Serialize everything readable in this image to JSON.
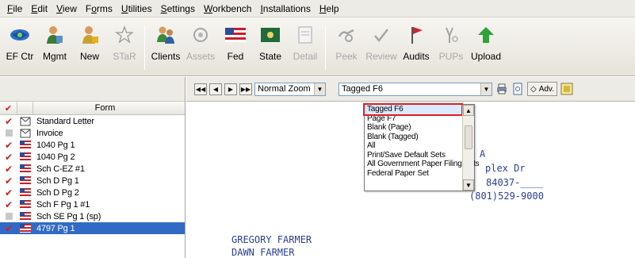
{
  "menu": [
    {
      "u": "F",
      "rest": "ile"
    },
    {
      "u": "E",
      "rest": "dit"
    },
    {
      "u": "V",
      "rest": "iew"
    },
    {
      "pre": "F",
      "u": "o",
      "rest": "rms"
    },
    {
      "u": "U",
      "rest": "tilities"
    },
    {
      "u": "S",
      "rest": "ettings"
    },
    {
      "u": "W",
      "rest": "orkbench"
    },
    {
      "u": "I",
      "rest": "nstallations"
    },
    {
      "u": "H",
      "rest": "elp"
    }
  ],
  "toolbar": {
    "ef_ctr": "EF Ctr",
    "mgmt": "Mgmt",
    "new": "New",
    "star": "STaR",
    "clients": "Clients",
    "assets": "Assets",
    "fed": "Fed",
    "state": "State",
    "detail": "Detail",
    "peek": "Peek",
    "review": "Review",
    "audits": "Audits",
    "pups": "PUPs",
    "upload": "Upload"
  },
  "forms_header": "Form",
  "forms": [
    {
      "name": "Standard Letter",
      "checked": true,
      "icon": "letter-icon"
    },
    {
      "name": "Invoice",
      "checked": false,
      "icon": "letter-icon"
    },
    {
      "name": "1040 Pg 1",
      "checked": true,
      "icon": "flag-icon"
    },
    {
      "name": "1040 Pg 2",
      "checked": true,
      "icon": "flag-icon"
    },
    {
      "name": "Sch C-EZ #1",
      "checked": true,
      "icon": "flag-icon"
    },
    {
      "name": "Sch D Pg 1",
      "checked": true,
      "icon": "flag-icon"
    },
    {
      "name": "Sch D Pg 2",
      "checked": true,
      "icon": "flag-icon"
    },
    {
      "name": "Sch F Pg 1 #1",
      "checked": true,
      "icon": "flag-icon"
    },
    {
      "name": "Sch SE Pg 1 (sp)",
      "checked": false,
      "icon": "flag-icon"
    },
    {
      "name": "4797 Pg 1",
      "checked": true,
      "icon": "flag-icon",
      "selected": true
    }
  ],
  "doc_toolbar": {
    "zoom": "Normal Zoom",
    "print_set": "Tagged  F6",
    "adv": "Adv."
  },
  "dropdown_options": [
    "Tagged  F6",
    "Page      F7",
    "Blank (Page)",
    "Blank (Tagged)",
    "All",
    "Print/Save Default Sets",
    "All Government Paper Filing Sets",
    "   Federal Paper Set"
  ],
  "document": {
    "line_a": "A",
    "line_addr": "plex Dr",
    "line_zip": "84037-____",
    "line_phone": "(801)529-9000",
    "name1": "GREGORY FARMER",
    "name2": "DAWN FARMER"
  },
  "colors": {
    "check_red": "#d21d1d",
    "selection_blue": "#316ac5",
    "highlight_red": "#e21c23",
    "doc_text_blue": "#2a3f99"
  }
}
